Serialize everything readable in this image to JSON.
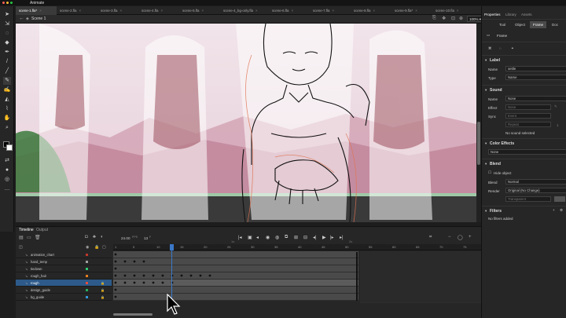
{
  "app": {
    "name": "Animate"
  },
  "doc_tabs": [
    "scene-1.fla*",
    "scene-2.fla",
    "scene-3.fla",
    "scene-4.fla",
    "scene-5.fla",
    "scene-4_bg-only.fla",
    "scene-6.fla",
    "scene-7.fla",
    "scene-8.fla",
    "scene-9.fla*",
    "scene-10.fla"
  ],
  "scene": {
    "label": "Scene 1",
    "zoom": "100%"
  },
  "timeline": {
    "tabs": [
      "Timeline",
      "Output"
    ],
    "fps": "24.00",
    "fps_unit": "FPS",
    "current_frame": "13",
    "frame_unit": "F",
    "ruler": [
      "1",
      "5",
      "10",
      "15",
      "20",
      "25",
      "30",
      "35",
      "40",
      "45",
      "50",
      "55",
      "60",
      "65",
      "70",
      "75"
    ],
    "ruler_1s": "1s",
    "ruler_2s": "2s",
    "layers": [
      {
        "name": "animation_chart",
        "color": "#c0392b"
      },
      {
        "name": "hand_temp",
        "color": "#a0a0a0"
      },
      {
        "name": "tiedown",
        "color": "#2ecc71"
      },
      {
        "name": "rough_hair",
        "color": "#e67e22"
      },
      {
        "name": "rough",
        "color": "#e74c3c",
        "selected": true
      },
      {
        "name": "design_guide",
        "color": "#27ae60"
      },
      {
        "name": "bg_guide",
        "color": "#3498db"
      }
    ]
  },
  "properties": {
    "tabs": [
      "Properties",
      "Library",
      "Assets"
    ],
    "subtabs": [
      "Tool",
      "Object",
      "Frame",
      "Doc"
    ],
    "frame_title": "Frame",
    "label_section": "Label",
    "name_label": "Name",
    "name_value": "settle",
    "type_label": "Type",
    "type_value": "Name",
    "sound_section": "Sound",
    "sound_name": "None",
    "effect_label": "Effect",
    "effect_value": "None",
    "sync_label": "Sync",
    "sync_value": "Event",
    "repeat_value": "Repeat",
    "repeat_count": "1",
    "no_sound": "No sound selected",
    "color_effects_section": "Color Effects",
    "color_effects_value": "None",
    "blend_section": "Blend",
    "hide_object": "Hide object",
    "blend_label": "Blend",
    "blend_value": "Normal",
    "render_label": "Render",
    "render_value": "Original (No Change)",
    "transparent_value": "Transparent",
    "filters_section": "Filters",
    "no_filters": "No filters added"
  }
}
